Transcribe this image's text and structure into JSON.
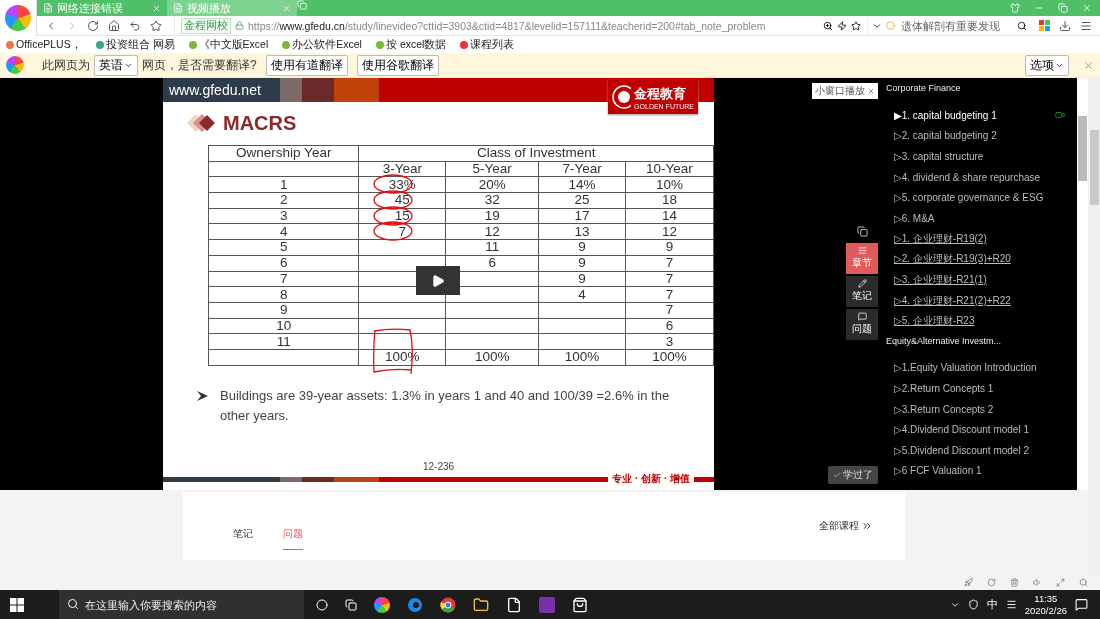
{
  "browser": {
    "tabs": [
      {
        "title": "网络连接错误",
        "selected": false
      },
      {
        "title": "视频播放",
        "selected": true
      }
    ],
    "address": {
      "site_badge": "金程网校",
      "url": "https://**www.gfedu.cn**/study/linevideo?cttid=3903&ctid=4817&levelid=157111&teacherid=200#tab_note_problem"
    },
    "search": {
      "placeholder": "遗体解剖有重要发现"
    },
    "bookmarks": [
      "OfficePLUS，",
      "投资组合 网易",
      "《中文版Excel",
      "办公软件Excel",
      "按 excel数据",
      "课程列表"
    ],
    "translate_bar": {
      "prefix": "此网页为",
      "language": "英语",
      "suffix": "网页，是否需要翻译?",
      "buttons": [
        "使用有道翻译",
        "使用谷歌翻译"
      ],
      "options": "选项"
    }
  },
  "slide": {
    "site": "www.gfedu.net",
    "logo_cn": "金程教育",
    "logo_en": "GOLDEN FUTURE",
    "title": "MACRS",
    "table": {
      "row_header": "Ownership Year",
      "group_header": "Class of Investment",
      "columns": [
        null,
        "3-Year",
        "5-Year",
        "7-Year",
        "10-Year"
      ],
      "rows": [
        {
          "cells": [
            "1",
            "33%",
            "20%",
            "14%",
            "10%"
          ],
          "circled": true
        },
        {
          "cells": [
            "2",
            "45",
            "32",
            "25",
            "18"
          ],
          "circled": true
        },
        {
          "cells": [
            "3",
            "15",
            "19",
            "17",
            "14"
          ],
          "circled": true
        },
        {
          "cells": [
            "4",
            "7",
            "12",
            "13",
            "12"
          ],
          "circled": true
        },
        {
          "cells": [
            "5",
            null,
            "11",
            "9",
            "9"
          ]
        },
        {
          "cells": [
            "6",
            null,
            "6",
            "9",
            "7"
          ]
        },
        {
          "cells": [
            "7",
            null,
            null,
            "9",
            "7"
          ]
        },
        {
          "cells": [
            "8",
            null,
            null,
            "4",
            "7"
          ]
        },
        {
          "cells": [
            "9",
            null,
            null,
            null,
            "7"
          ]
        },
        {
          "cells": [
            "10",
            null,
            null,
            null,
            "6"
          ]
        },
        {
          "cells": [
            "11",
            null,
            null,
            null,
            "3"
          ]
        },
        {
          "cells": [
            null,
            "100%",
            "100%",
            "100%",
            "100%"
          ],
          "boxed": true
        }
      ]
    },
    "bullet": "Buildings are 39-year assets: 1.3% in years 1 and 40 and 100/39 =2.6% in the other years.",
    "page": "12-236",
    "slogan": "专业 · 创新 · 增值"
  },
  "player": {
    "mini_window": "小窗口播放",
    "side_buttons": [
      {
        "label": "章节",
        "kind": "chapters",
        "selected": true
      },
      {
        "label": "笔记",
        "kind": "notes",
        "selected": false
      },
      {
        "label": "问题",
        "kind": "questions",
        "selected": false
      }
    ],
    "done_button": "学过了"
  },
  "chapters": [
    {
      "title": "Corporate Finance",
      "items": [
        {
          "label": "▶1. capital budgeting 1",
          "current": true
        },
        {
          "label": "▷2. capital budgeting 2",
          "current": false
        },
        {
          "label": "▷3. capital structure",
          "current": false
        },
        {
          "label": "▷4. dividend & share repurchase",
          "current": false
        },
        {
          "label": "▷5. corporate governance & ESG",
          "current": false
        },
        {
          "label": "▷6. M&A",
          "current": false
        },
        {
          "label": "▷1. 企业理财-R19(2)",
          "current": false,
          "link": true
        },
        {
          "label": "▷2. 企业理财-R19(3)+R20",
          "current": false,
          "link": true
        },
        {
          "label": "▷3. 企业理财-R21(1)",
          "current": false,
          "link": true
        },
        {
          "label": "▷4. 企业理财-R21(2)+R22",
          "current": false,
          "link": true
        },
        {
          "label": "▷5. 企业理财-R23",
          "current": false,
          "link": true
        }
      ]
    },
    {
      "title": "Equity&Alternative Investm...",
      "items": [
        {
          "label": "▷1.Equity Valuation Introduction",
          "current": false
        },
        {
          "label": "▷2.Return Concepts 1",
          "current": false
        },
        {
          "label": "▷3.Return Concepts 2",
          "current": false
        },
        {
          "label": "▷4.Dividend Discount model 1",
          "current": false
        },
        {
          "label": "▷5.Dividend Discount model 2",
          "current": false
        },
        {
          "label": "▷6 FCF Valuation 1",
          "current": false
        }
      ]
    }
  ],
  "bottom": {
    "tabs": [
      {
        "label": "笔记",
        "selected": false
      },
      {
        "label": "问题",
        "selected": true
      }
    ],
    "all_courses": "全部课程"
  },
  "taskbar": {
    "search_placeholder": "在这里输入你要搜索的内容",
    "ime": "中",
    "time": "11:35",
    "date": "2020/2/26"
  }
}
